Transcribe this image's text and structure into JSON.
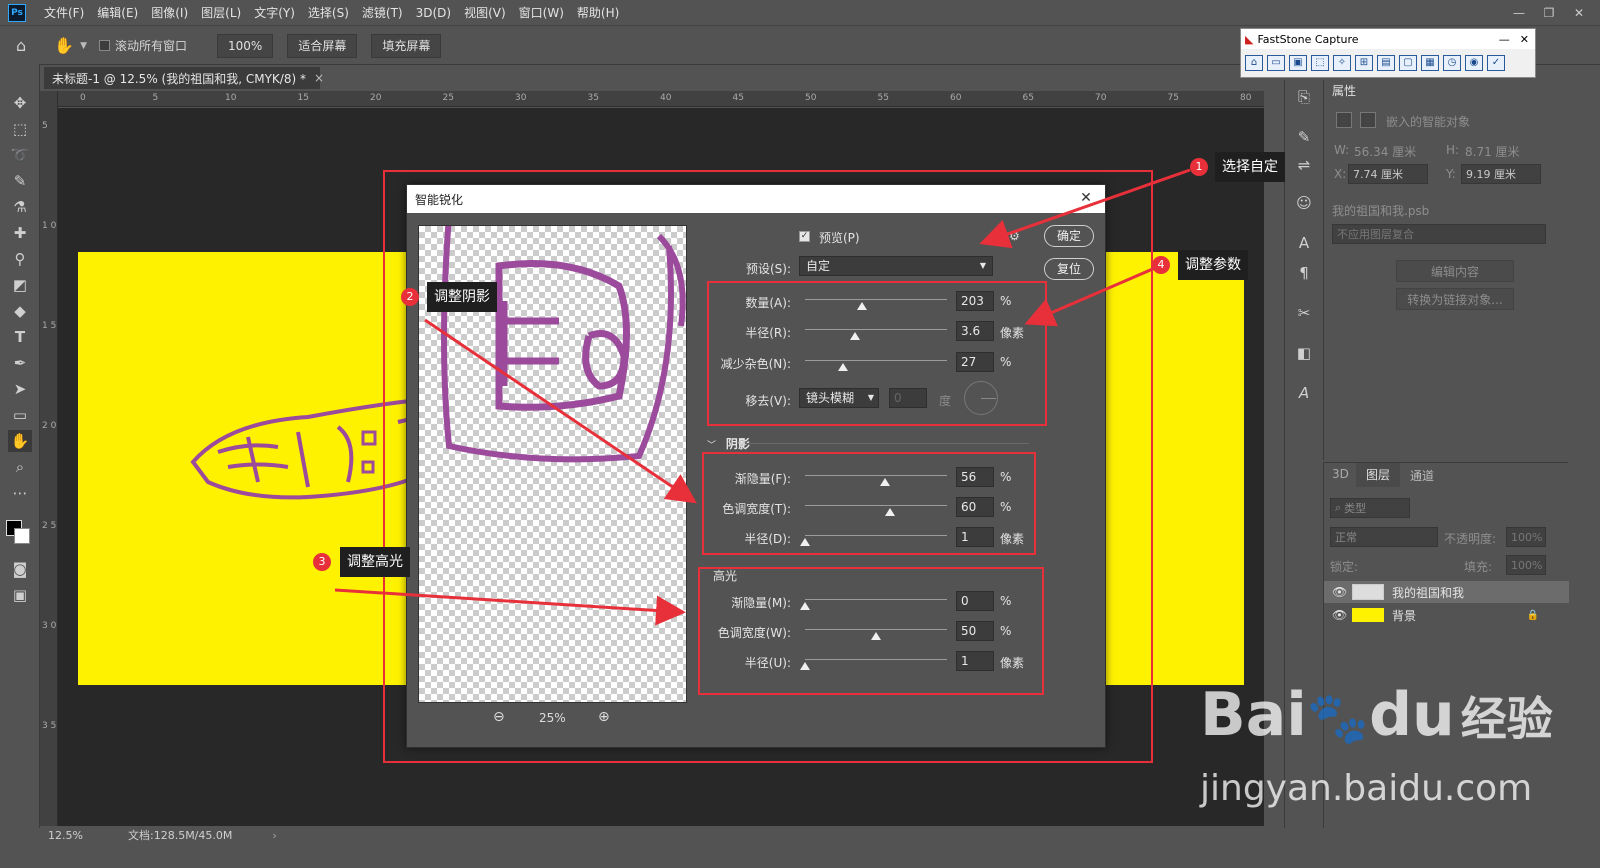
{
  "app": {
    "logo": "Ps",
    "menu": [
      "文件(F)",
      "编辑(E)",
      "图像(I)",
      "图层(L)",
      "文字(Y)",
      "选择(S)",
      "滤镜(T)",
      "3D(D)",
      "视图(V)",
      "窗口(W)",
      "帮助(H)"
    ],
    "window_controls": [
      "—",
      "❐",
      "✕"
    ]
  },
  "options": {
    "scroll_all": "滚动所有窗口",
    "zoom_btn": "100%",
    "fit_screen": "适合屏幕",
    "fill_screen": "填充屏幕"
  },
  "document": {
    "tab_title": "未标题-1 @ 12.5% (我的祖国和我, CMYK/8) *",
    "tab_close": "×",
    "zoom": "12.5%",
    "doc_info": "文档:128.5M/45.0M",
    "ruler_ticks": [
      "0",
      "5",
      "10",
      "15",
      "20",
      "25",
      "30",
      "35",
      "40",
      "45",
      "50",
      "55",
      "60",
      "65",
      "70",
      "75",
      "80"
    ],
    "vruler_ticks": [
      "5",
      "1 0",
      "1 5",
      "2 0",
      "2 5",
      "3 0",
      "3 5"
    ]
  },
  "faststone": {
    "title": "FastStone Capture"
  },
  "properties": {
    "tab": "属性",
    "type": "嵌入的智能对象",
    "w_label": "W:",
    "w_value": "56.34 厘米",
    "h_label": "H:",
    "h_value": "8.71 厘米",
    "x_label": "X:",
    "x_value": "7.74 厘米",
    "y_label": "Y:",
    "y_value": "9.19 厘米",
    "file": "我的祖国和我.psb",
    "comp": "不应用图层复合",
    "edit_btn": "编辑内容",
    "convert_btn": "转换为链接对象..."
  },
  "layers": {
    "tabs": [
      "3D",
      "图层",
      "通道"
    ],
    "filter_placeholder": "类型",
    "blend_mode": "正常",
    "opacity_label": "不透明度:",
    "opacity_value": "100%",
    "lock_label": "锁定:",
    "fill_label": "填充:",
    "fill_value": "100%",
    "items": [
      {
        "name": "我的祖国和我"
      },
      {
        "name": "背景"
      }
    ]
  },
  "dialog": {
    "title": "智能锐化",
    "preview_label": "预览(P)",
    "ok": "确定",
    "reset": "复位",
    "preset_label": "预设(S):",
    "preset_value": "自定",
    "amount_label": "数量(A):",
    "amount_value": "203",
    "amount_unit": "%",
    "radius_label": "半径(R):",
    "radius_value": "3.6",
    "radius_unit": "像素",
    "noise_label": "减少杂色(N):",
    "noise_value": "27",
    "noise_unit": "%",
    "remove_label": "移去(V):",
    "remove_value": "镜头模糊",
    "angle_value": "0",
    "angle_unit": "度",
    "shadow_title": "阴影",
    "sh_fade_label": "渐隐量(F):",
    "sh_fade_value": "56",
    "sh_fade_unit": "%",
    "sh_tonal_label": "色调宽度(T):",
    "sh_tonal_value": "60",
    "sh_tonal_unit": "%",
    "sh_radius_label": "半径(D):",
    "sh_radius_value": "1",
    "sh_radius_unit": "像素",
    "highlight_title": "高光",
    "hl_fade_label": "渐隐量(M):",
    "hl_fade_value": "0",
    "hl_fade_unit": "%",
    "hl_tonal_label": "色调宽度(W):",
    "hl_tonal_value": "50",
    "hl_tonal_unit": "%",
    "hl_radius_label": "半径(U):",
    "hl_radius_value": "1",
    "hl_radius_unit": "像素",
    "zoom_value": "25%",
    "sliders": {
      "amount": 0.4,
      "radius": 0.35,
      "noise": 0.27,
      "sh_fade": 0.56,
      "sh_tonal": 0.6,
      "sh_radius": 0.0,
      "hl_fade": 0.0,
      "hl_tonal": 0.5,
      "hl_radius": 0.0
    }
  },
  "annotations": {
    "n1": "1",
    "c1": "选择自定",
    "n2": "2",
    "c2": "调整阴影",
    "n3": "3",
    "c3": "调整高光",
    "n4": "4",
    "c4": "调整参数"
  },
  "watermark": {
    "brand": "Bai",
    "brand2": "du",
    "cn": "经验",
    "url": "jingyan.baidu.com"
  },
  "colors": {
    "accent_red": "#e8303a",
    "canvas_yellow": "#fff200",
    "artwork_purple": "#9b4a9c"
  }
}
